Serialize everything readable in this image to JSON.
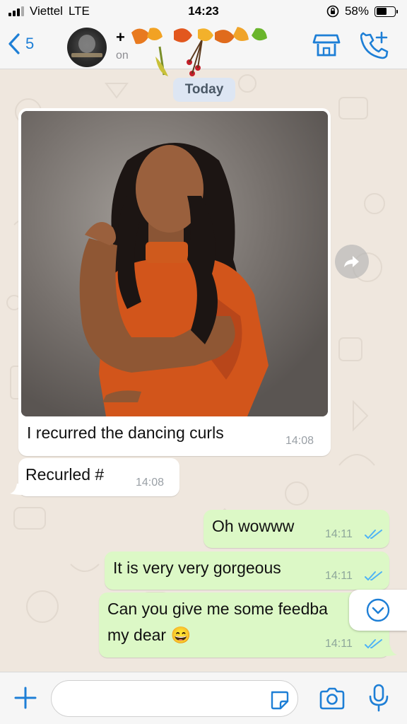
{
  "status_bar": {
    "carrier": "Viettel",
    "network": "LTE",
    "time": "14:23",
    "battery": "58%",
    "battery_level": 0.58
  },
  "header": {
    "back_count": "5",
    "contact_name": "+",
    "contact_status": "on",
    "icons": [
      "chevron-left-icon",
      "shop-icon",
      "phone-add-icon"
    ]
  },
  "chat": {
    "date_label": "Today",
    "messages": [
      {
        "direction": "in",
        "type": "photo",
        "caption": "I recurred the dancing curls",
        "time": "14:08"
      },
      {
        "direction": "in",
        "type": "text",
        "text": "Recurled #",
        "time": "14:08"
      },
      {
        "direction": "out",
        "type": "text",
        "text": "Oh wowww",
        "time": "14:11"
      },
      {
        "direction": "out",
        "type": "text",
        "text": "It is very very gorgeous",
        "time": "14:11"
      },
      {
        "direction": "out",
        "type": "text",
        "text_line1": "Can you give me some feedba",
        "text_line2": "my dear 😄",
        "time": "14:11"
      }
    ]
  },
  "input_bar": {
    "placeholder": "",
    "icons": [
      "plus-icon",
      "sticker-icon",
      "camera-icon",
      "mic-icon"
    ]
  },
  "colors": {
    "accent": "#1e7fd6",
    "incoming": "#ffffff",
    "outgoing": "#dcf8c6",
    "read_ticks": "#4fb3f6",
    "chat_bg": "#efe7de"
  }
}
